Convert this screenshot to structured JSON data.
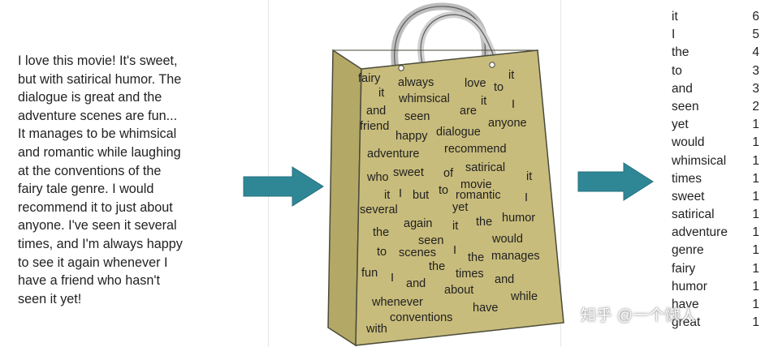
{
  "review": {
    "lines": [
      "I love this movie! It's sweet,",
      "but with satirical humor. The",
      "dialogue is great and the",
      "adventure scenes are fun...",
      "It manages to be whimsical",
      "and romantic while laughing",
      "at the conventions of the",
      "fairy tale genre. I would",
      "recommend it to just about",
      "anyone. I've seen it several",
      "times, and I'm always happy",
      "to see it again whenever I",
      "have a friend who hasn't",
      "seen it yet!"
    ]
  },
  "bag_words": [
    "fairy",
    "always",
    "love",
    "to",
    "it",
    "it",
    "whimsical",
    "it",
    "I",
    "and",
    "seen",
    "are",
    "friend",
    "anyone",
    "happy",
    "dialogue",
    "adventure",
    "recommend",
    "sweet",
    "of",
    "satirical",
    "who",
    "it",
    "movie",
    "I",
    "but",
    "to",
    "romantic",
    "it",
    "I",
    "yet",
    "several",
    "again",
    "it",
    "the",
    "humor",
    "the",
    "seen",
    "would",
    "to",
    "scenes",
    "I",
    "the",
    "manages",
    "the",
    "fun",
    "I",
    "times",
    "and",
    "and",
    "about",
    "while",
    "whenever",
    "have",
    "with",
    "conventions"
  ],
  "word_counts": [
    {
      "word": "it",
      "count": "6"
    },
    {
      "word": "I",
      "count": "5"
    },
    {
      "word": "the",
      "count": "4"
    },
    {
      "word": "to",
      "count": "3"
    },
    {
      "word": "and",
      "count": "3"
    },
    {
      "word": "seen",
      "count": "2"
    },
    {
      "word": "yet",
      "count": "1"
    },
    {
      "word": "would",
      "count": "1"
    },
    {
      "word": "whimsical",
      "count": "1"
    },
    {
      "word": "times",
      "count": "1"
    },
    {
      "word": "sweet",
      "count": "1"
    },
    {
      "word": "satirical",
      "count": "1"
    },
    {
      "word": "adventure",
      "count": "1"
    },
    {
      "word": "genre",
      "count": "1"
    },
    {
      "word": "fairy",
      "count": "1"
    },
    {
      "word": "humor",
      "count": "1"
    },
    {
      "word": "have",
      "count": "1"
    },
    {
      "word": "great",
      "count": "1"
    }
  ],
  "watermark": "知乎 @一个懒人",
  "colors": {
    "arrow": "#2f8796",
    "bag_fill": "#c8bc7c",
    "bag_side": "#b3a865",
    "bag_outline": "#4a4a3a",
    "handle": "#bfbfbf"
  }
}
